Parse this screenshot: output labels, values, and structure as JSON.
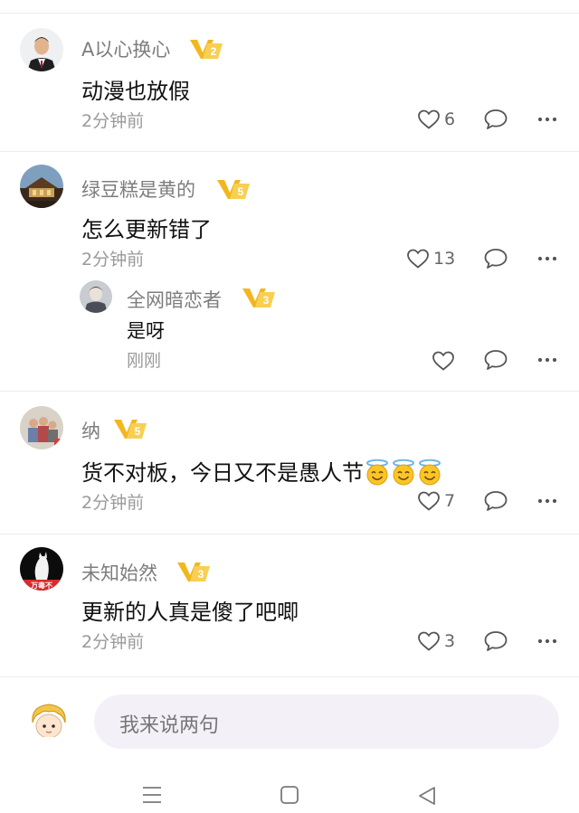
{
  "comments": [
    {
      "username": "A以心换心",
      "level": "2",
      "text": "动漫也放假",
      "time": "2分钟前",
      "likes": "6"
    },
    {
      "username": "绿豆糕是黄的",
      "level": "5",
      "text": "怎么更新错了",
      "time": "2分钟前",
      "likes": "13",
      "reply": {
        "username": "全网暗恋者",
        "level": "3",
        "text": "是呀",
        "time": "刚刚",
        "likes": ""
      }
    },
    {
      "username": "纳",
      "level": "5",
      "text": "货不对板，今日又不是愚人节",
      "emoji": [
        "smiling-face-with-halo",
        "smiling-face-with-halo",
        "smiling-face-with-halo"
      ],
      "time": "2分钟前",
      "likes": "7"
    },
    {
      "username": "未知始然",
      "level": "3",
      "text": "更新的人真是傻了吧唧",
      "time": "2分钟前",
      "likes": "3",
      "avatar_text": "万毒不"
    }
  ],
  "input": {
    "placeholder": "我来说两句"
  },
  "icons": {
    "like": "heart-outline-icon",
    "reply": "speech-bubble-icon",
    "more": "more-dots-icon",
    "nav_menu": "menu-lines-icon",
    "nav_home": "square-home-icon",
    "nav_back": "triangle-back-icon"
  },
  "colors": {
    "badge_gold": "#f2b71f",
    "muted_text": "#9a9a9a",
    "input_bg": "#f3f1f7"
  }
}
